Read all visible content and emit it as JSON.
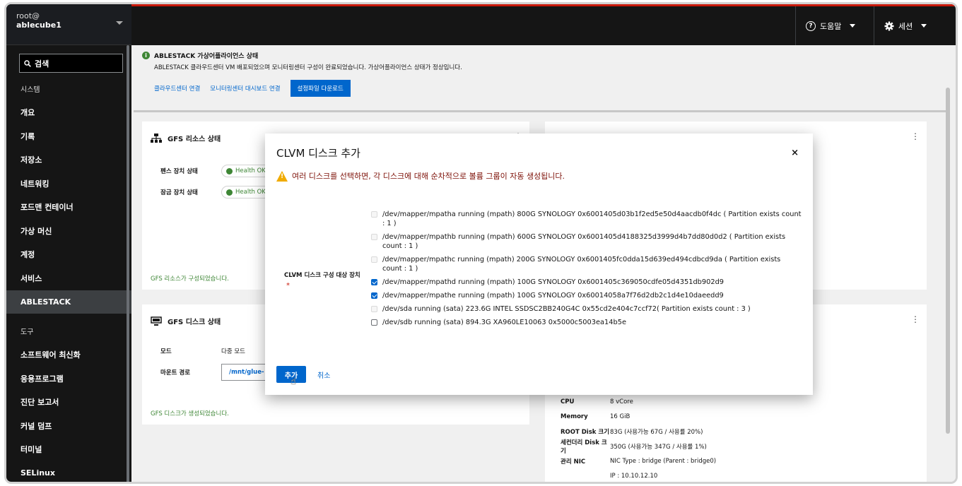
{
  "sidebar": {
    "user_line1": "root@",
    "user_line2": "ablecube1",
    "search_label": "검색",
    "items": [
      {
        "label": "시스템",
        "section": true
      },
      {
        "label": "개요"
      },
      {
        "label": "기록"
      },
      {
        "label": "저장소"
      },
      {
        "label": "네트워킹"
      },
      {
        "label": "포드맨 컨테이너"
      },
      {
        "label": "가상 머신"
      },
      {
        "label": "계정"
      },
      {
        "label": "서비스"
      },
      {
        "label": "ABLESTACK",
        "active": true
      },
      {
        "label": "도구",
        "section": true
      },
      {
        "label": "소프트웨어 최신화"
      },
      {
        "label": "응용프로그램"
      },
      {
        "label": "진단 보고서"
      },
      {
        "label": "커널 덤프"
      },
      {
        "label": "터미널"
      },
      {
        "label": "SELinux"
      }
    ]
  },
  "topbar": {
    "help_label": "도움말",
    "session_label": "세션"
  },
  "alert": {
    "title": "ABLESTACK 가상어플라이언스 상태",
    "message": "ABLESTACK 클라우드센터 VM 배포되었으며 모니터링센터 구성이 완료되었습니다. 가상어플라이언스 상태가 정상입니다.",
    "link1": "클라우드센터 연결",
    "link2": "모니터링센터 대시보드 연결",
    "button": "설정파일 다운로드"
  },
  "gfs_resource": {
    "title": "GFS 리소스 상태",
    "row1_label": "펜스 장치 상태",
    "row1_value": "Health OK",
    "row2_label": "잠금 장치 상태",
    "row2_value": "Health OK",
    "footer": "GFS 리소스가 구성되었습니다."
  },
  "gfs_disk": {
    "title": "GFS 디스크 상태",
    "mode_label": "모드",
    "mode_value": "다중 모드",
    "mount_label": "마운트 경로",
    "mount_value": "/mnt/glue-",
    "footer": "GFS 디스크가 생성되었습니다."
  },
  "vm_info": [
    {
      "k": "CPU",
      "v": "8 vCore"
    },
    {
      "k": "Memory",
      "v": "16 GiB"
    },
    {
      "k": "ROOT Disk 크기",
      "v": "83G (사용가능 67G / 사용률 20%)"
    },
    {
      "k": "세컨더리 Disk 크기",
      "v": "350G (사용가능 347G / 사용률 1%)"
    },
    {
      "k": "관리 NIC",
      "v": "NIC Type : bridge (Parent : bridge0)"
    },
    {
      "k": "",
      "v": "IP : 10.10.12.10"
    }
  ],
  "modal": {
    "title": "CLVM 디스크 추가",
    "close": "×",
    "warning": "여러 디스크를 선택하면, 각 디스크에 대해 순차적으로 볼륨 그룹이 자동 생성됩니다.",
    "field_label": "CLVM 디스크 구성 대상 장치",
    "required": "*",
    "options": [
      {
        "text": "/dev/mapper/mpatha running (mpath) 800G SYNOLOGY 0x6001405d03b1f2ed5e50d4aacdb0f4dc ( Partition exists count : 1 )",
        "state": "disabled"
      },
      {
        "text": "/dev/mapper/mpathb running (mpath) 600G SYNOLOGY 0x6001405d4188325d3999d4b7dd80d0d2 ( Partition exists count : 1 )",
        "state": "disabled"
      },
      {
        "text": "/dev/mapper/mpathc running (mpath) 200G SYNOLOGY 0x6001405fc0dda15d639ed494cdbcd9da ( Partition exists count : 1 )",
        "state": "disabled"
      },
      {
        "text": "/dev/mapper/mpathd running (mpath) 100G SYNOLOGY 0x6001405c369050cdfe05d4351db902d9",
        "state": "checked"
      },
      {
        "text": "/dev/mapper/mpathe running (mpath) 100G SYNOLOGY 0x60014058a7f76d2db2c1d4e10daeedd9",
        "state": "checked"
      },
      {
        "text": "/dev/sda running (sata) 223.6G INTEL SSDSC2BB240G4C 0x55cd2e404c7ccf72( Partition exists count : 3 )",
        "state": "disabled"
      },
      {
        "text": "/dev/sdb running (sata) 894.3G XA960LE10063 0x5000c5003ea14b5e",
        "state": "unchecked"
      }
    ],
    "add_button": "추가",
    "cancel_button": "취소"
  }
}
